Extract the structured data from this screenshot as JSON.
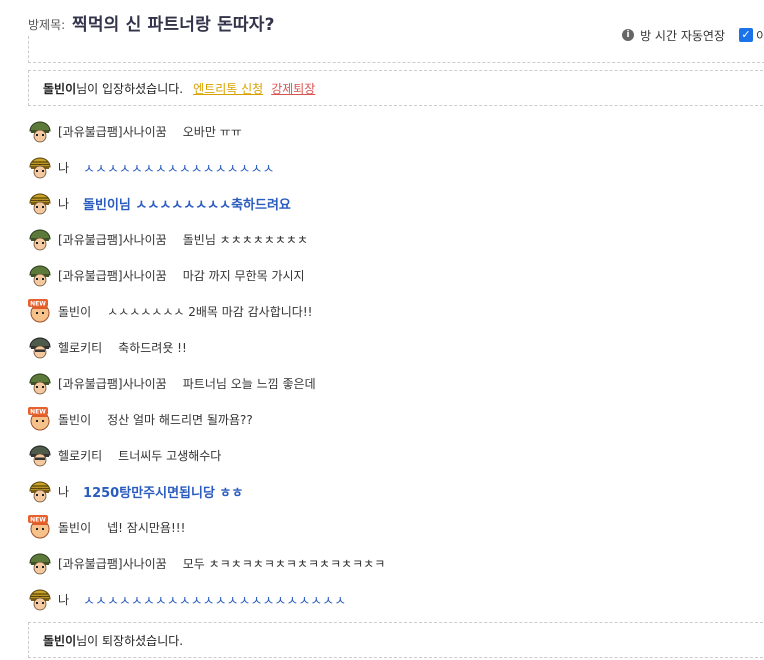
{
  "header": {
    "title_label": "방제목:",
    "title": "찍먹의 신 파트너랑 돈따자?",
    "extend_label": "방 시간 자동연장",
    "checkbox_label": "이"
  },
  "system": {
    "enter": {
      "user": "돌빈이",
      "suffix": "님이 입장하셨습니다.",
      "link1": "엔트리톡 신청",
      "link2": "강제퇴장"
    },
    "leave": {
      "user": "돌빈이",
      "suffix": "님이 퇴장하셨습니다."
    }
  },
  "messages": [
    {
      "avatar": "soldier",
      "name": "[과유불급팸]사나이꿈",
      "text": "오바만 ㅠㅠ",
      "me": false
    },
    {
      "avatar": "general",
      "name": "나",
      "text": "ㅅㅅㅅㅅㅅㅅㅅㅅㅅㅅㅅㅅㅅㅅㅅㅅ",
      "me": true,
      "thin": true
    },
    {
      "avatar": "general",
      "name": "나",
      "text": "돌빈이님 ㅅㅅㅅㅅㅅㅅㅅㅅ축하드려요",
      "me": true
    },
    {
      "avatar": "soldier",
      "name": "[과유불급팸]사나이꿈",
      "text": "돌빈님 ㅊㅊㅊㅊㅊㅊㅊㅊ",
      "me": false
    },
    {
      "avatar": "soldier",
      "name": "[과유불급팸]사나이꿈",
      "text": "마감 까지 무한목 가시지",
      "me": false
    },
    {
      "avatar": "new",
      "name": "돌빈이",
      "text": "ㅅㅅㅅㅅㅅㅅㅅ 2배목 마감 감사합니다!!",
      "me": false
    },
    {
      "avatar": "helmet",
      "name": "헬로키티",
      "text": "축하드려욧 !!",
      "me": false
    },
    {
      "avatar": "soldier",
      "name": "[과유불급팸]사나이꿈",
      "text": "파트너님 오늘 느낌 좋은데",
      "me": false
    },
    {
      "avatar": "new",
      "name": "돌빈이",
      "text": "정산 얼마 해드리면 될까욤??",
      "me": false
    },
    {
      "avatar": "helmet",
      "name": "헬로키티",
      "text": "트너씨두 고생해수다",
      "me": false
    },
    {
      "avatar": "general",
      "name": "나",
      "text": "1250탕만주시면됩니당 ㅎㅎ",
      "me": true
    },
    {
      "avatar": "new",
      "name": "돌빈이",
      "text": "넵! 잠시만욤!!!",
      "me": false
    },
    {
      "avatar": "soldier",
      "name": "[과유불급팸]사나이꿈",
      "text": "모두 ㅊㅋㅊㅋㅊㅋㅊㅋㅊㅋㅊㅋㅊㅋㅊㅋ",
      "me": false
    },
    {
      "avatar": "general",
      "name": "나",
      "text": "ㅅㅅㅅㅅㅅㅅㅅㅅㅅㅅㅅㅅㅅㅅㅅㅅㅅㅅㅅㅅㅅㅅ",
      "me": true,
      "thin": true
    }
  ]
}
